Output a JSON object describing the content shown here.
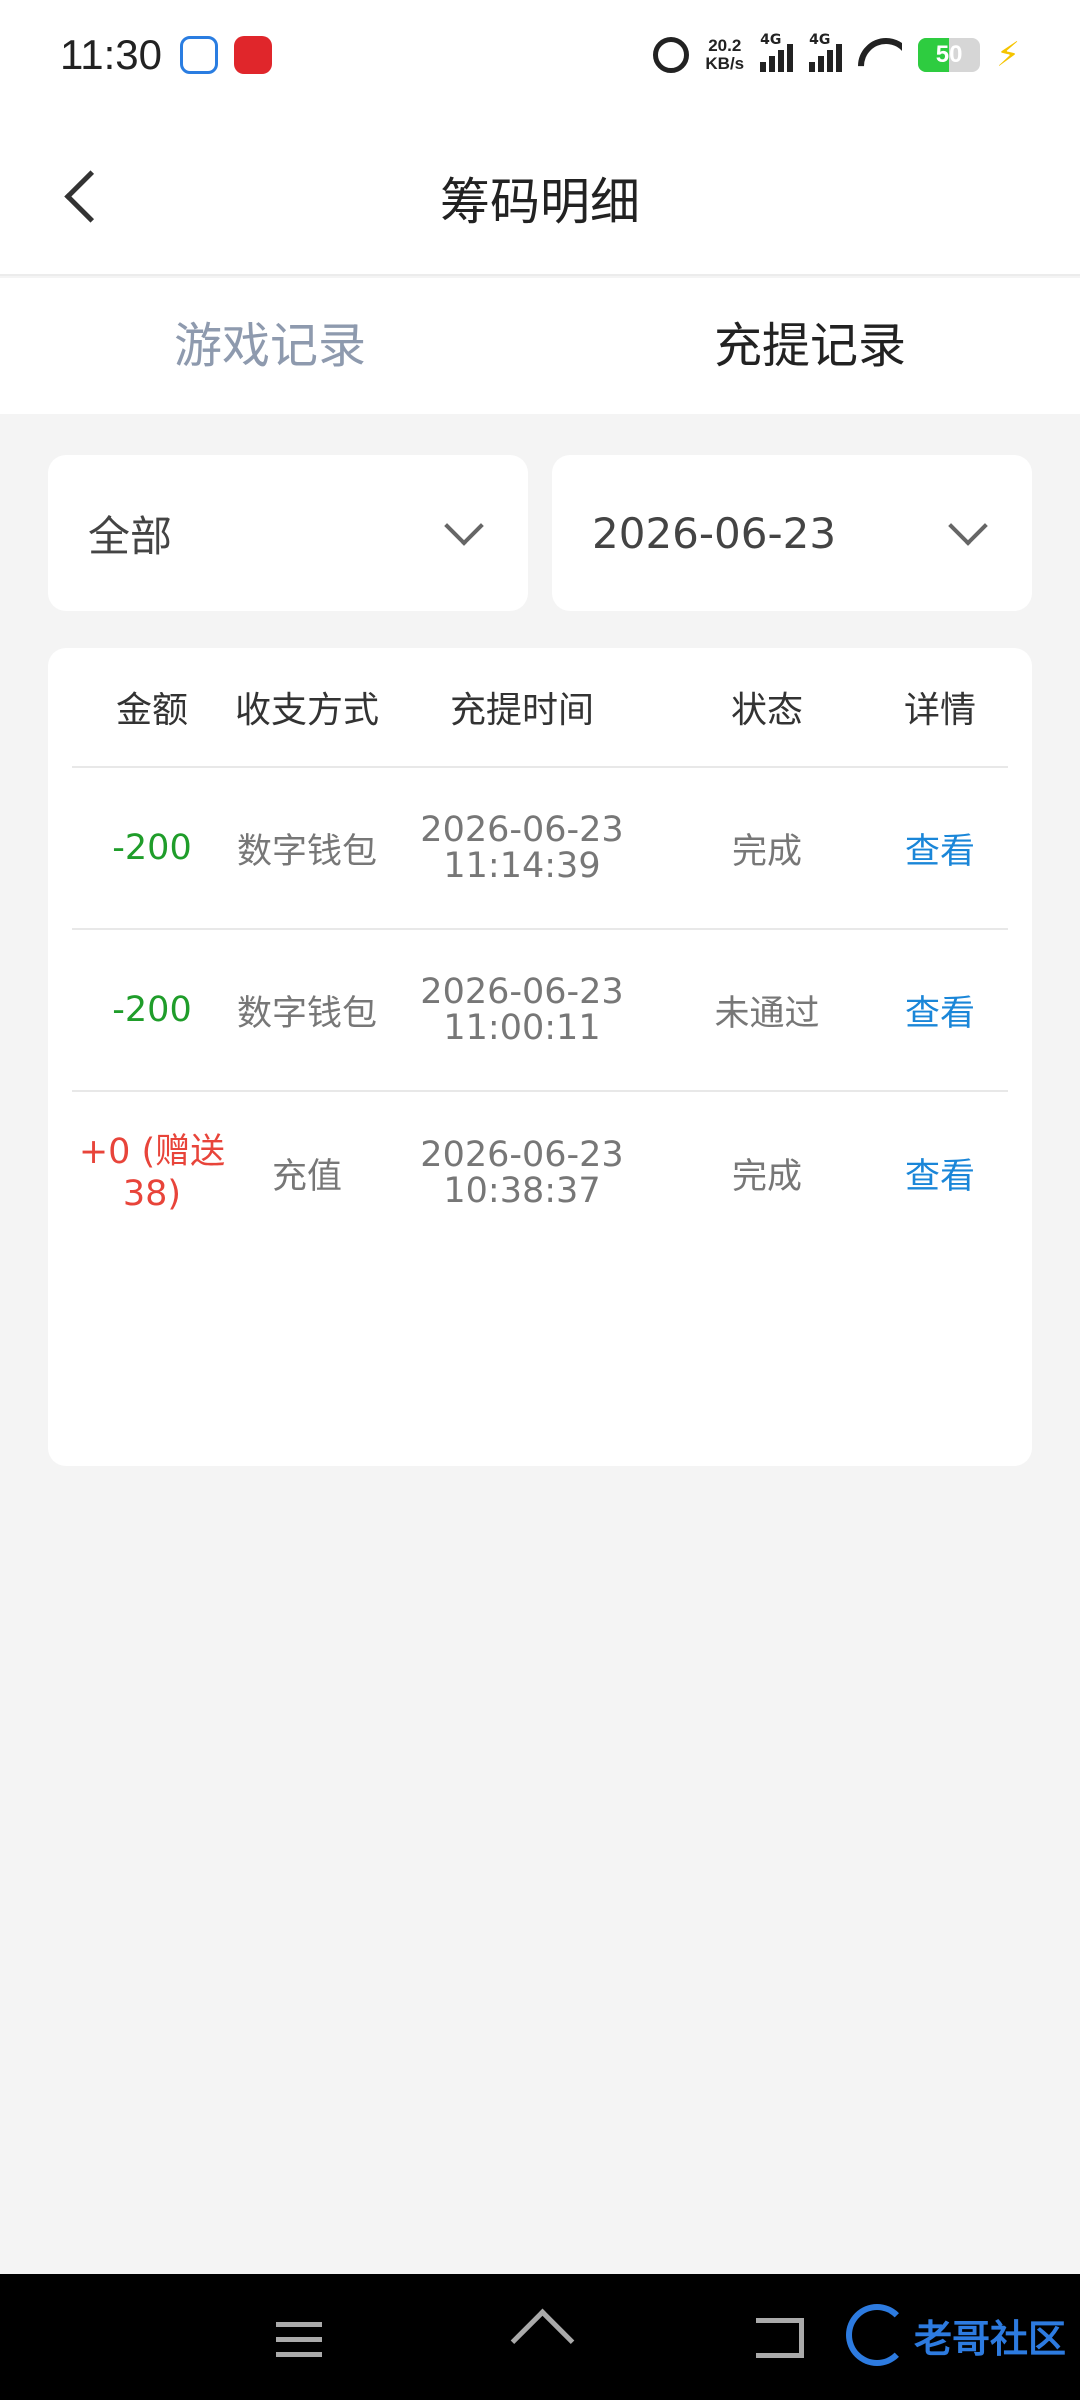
{
  "status_bar": {
    "time": "11:30",
    "net_speed_value": "20.2",
    "net_speed_unit": "KB/s",
    "signal1_label": "4G",
    "signal2_label": "4G",
    "battery_level": "50"
  },
  "header": {
    "title": "筹码明细"
  },
  "tabs": [
    {
      "label": "游戏记录",
      "active": false
    },
    {
      "label": "充提记录",
      "active": true
    }
  ],
  "filters": {
    "type_value": "全部",
    "date_value": "2026-06-23"
  },
  "table": {
    "headers": [
      "金额",
      "收支方式",
      "充提时间",
      "状态",
      "详情"
    ],
    "rows": [
      {
        "amount": "-200",
        "method": "数字钱包",
        "date": "2026-06-23",
        "time": "11:14:39",
        "status": "完成",
        "detail": "查看"
      },
      {
        "amount": "-200",
        "method": "数字钱包",
        "date": "2026-06-23",
        "time": "11:00:11",
        "status": "未通过",
        "detail": "查看"
      },
      {
        "amount_line1": "+0 (赠送",
        "amount_line2": "38)",
        "method": "充值",
        "date": "2026-06-23",
        "time": "10:38:37",
        "status": "完成",
        "detail": "查看"
      }
    ]
  },
  "watermark": {
    "text": "老哥社区"
  },
  "colors": {
    "negative_amount": "#1f9d2a",
    "positive_amount": "#e8443a",
    "link": "#1a86d8",
    "inactive_tab": "#8e9aae"
  }
}
